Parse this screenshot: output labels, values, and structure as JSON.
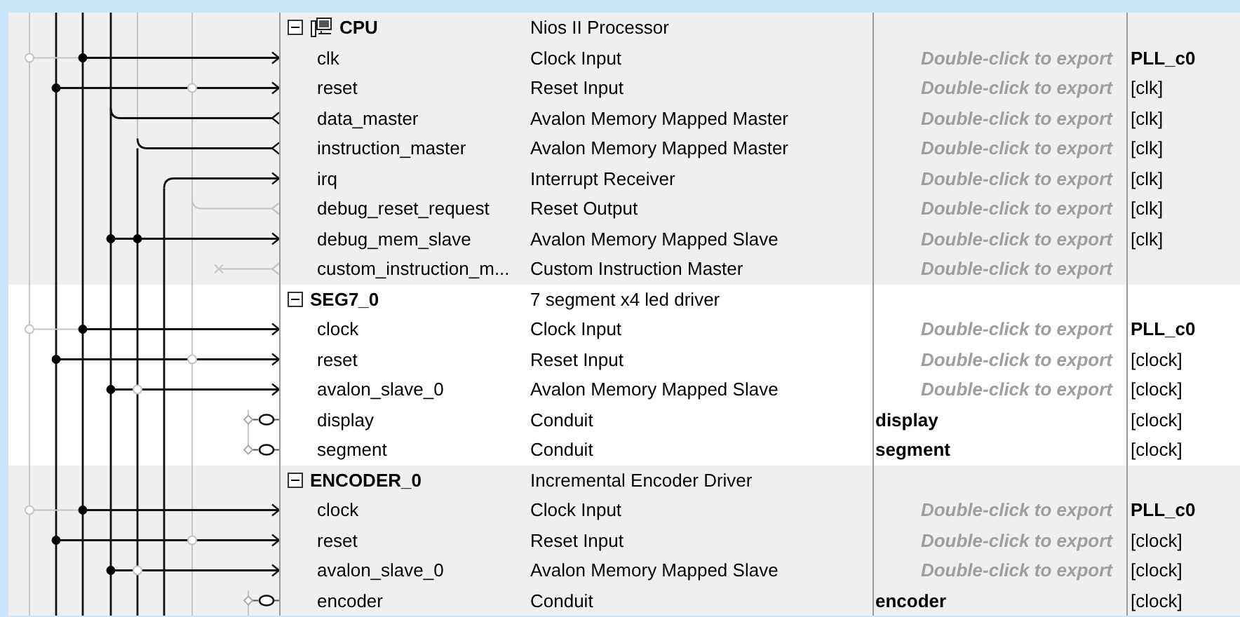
{
  "components": [
    {
      "name": "CPU",
      "description": "Nios II Processor",
      "expanded": true,
      "processor": true,
      "ports": [
        {
          "name": "clk",
          "description": "Clock Input",
          "export": "Double-click to export",
          "exported": false,
          "clock": "PLL_c0",
          "clock_direct": true
        },
        {
          "name": "reset",
          "description": "Reset Input",
          "export": "Double-click to export",
          "exported": false,
          "clock": "[clk]",
          "clock_direct": false
        },
        {
          "name": "data_master",
          "description": "Avalon Memory Mapped Master",
          "export": "Double-click to export",
          "exported": false,
          "clock": "[clk]",
          "clock_direct": false
        },
        {
          "name": "instruction_master",
          "description": "Avalon Memory Mapped Master",
          "export": "Double-click to export",
          "exported": false,
          "clock": "[clk]",
          "clock_direct": false
        },
        {
          "name": "irq",
          "description": "Interrupt Receiver",
          "export": "Double-click to export",
          "exported": false,
          "clock": "[clk]",
          "clock_direct": false
        },
        {
          "name": "debug_reset_request",
          "description": "Reset Output",
          "export": "Double-click to export",
          "exported": false,
          "clock": "[clk]",
          "clock_direct": false
        },
        {
          "name": "debug_mem_slave",
          "description": "Avalon Memory Mapped Slave",
          "export": "Double-click to export",
          "exported": false,
          "clock": "[clk]",
          "clock_direct": false
        },
        {
          "name": "custom_instruction_m...",
          "description": "Custom Instruction Master",
          "export": "Double-click to export",
          "exported": false
        }
      ]
    },
    {
      "name": "SEG7_0",
      "description": "7 segment x4 led driver",
      "expanded": true,
      "processor": false,
      "ports": [
        {
          "name": "clock",
          "description": "Clock Input",
          "export": "Double-click to export",
          "exported": false,
          "clock": "PLL_c0",
          "clock_direct": true
        },
        {
          "name": "reset",
          "description": "Reset Input",
          "export": "Double-click to export",
          "exported": false,
          "clock": "[clock]",
          "clock_direct": false
        },
        {
          "name": "avalon_slave_0",
          "description": "Avalon Memory Mapped Slave",
          "export": "Double-click to export",
          "exported": false,
          "clock": "[clock]",
          "clock_direct": false
        },
        {
          "name": "display",
          "description": "Conduit",
          "export": "display",
          "exported": true,
          "clock": "[clock]",
          "clock_direct": false
        },
        {
          "name": "segment",
          "description": "Conduit",
          "export": "segment",
          "exported": true,
          "clock": "[clock]",
          "clock_direct": false
        }
      ]
    },
    {
      "name": "ENCODER_0",
      "description": "Incremental Encoder Driver",
      "expanded": true,
      "processor": false,
      "ports": [
        {
          "name": "clock",
          "description": "Clock Input",
          "export": "Double-click to export",
          "exported": false,
          "clock": "PLL_c0",
          "clock_direct": true
        },
        {
          "name": "reset",
          "description": "Reset Input",
          "export": "Double-click to export",
          "exported": false,
          "clock": "[clock]",
          "clock_direct": false
        },
        {
          "name": "avalon_slave_0",
          "description": "Avalon Memory Mapped Slave",
          "export": "Double-click to export",
          "exported": false,
          "clock": "[clock]",
          "clock_direct": false
        },
        {
          "name": "encoder",
          "description": "Conduit",
          "export": "encoder",
          "exported": true,
          "clock": "[clock]",
          "clock_direct": false
        }
      ]
    }
  ]
}
